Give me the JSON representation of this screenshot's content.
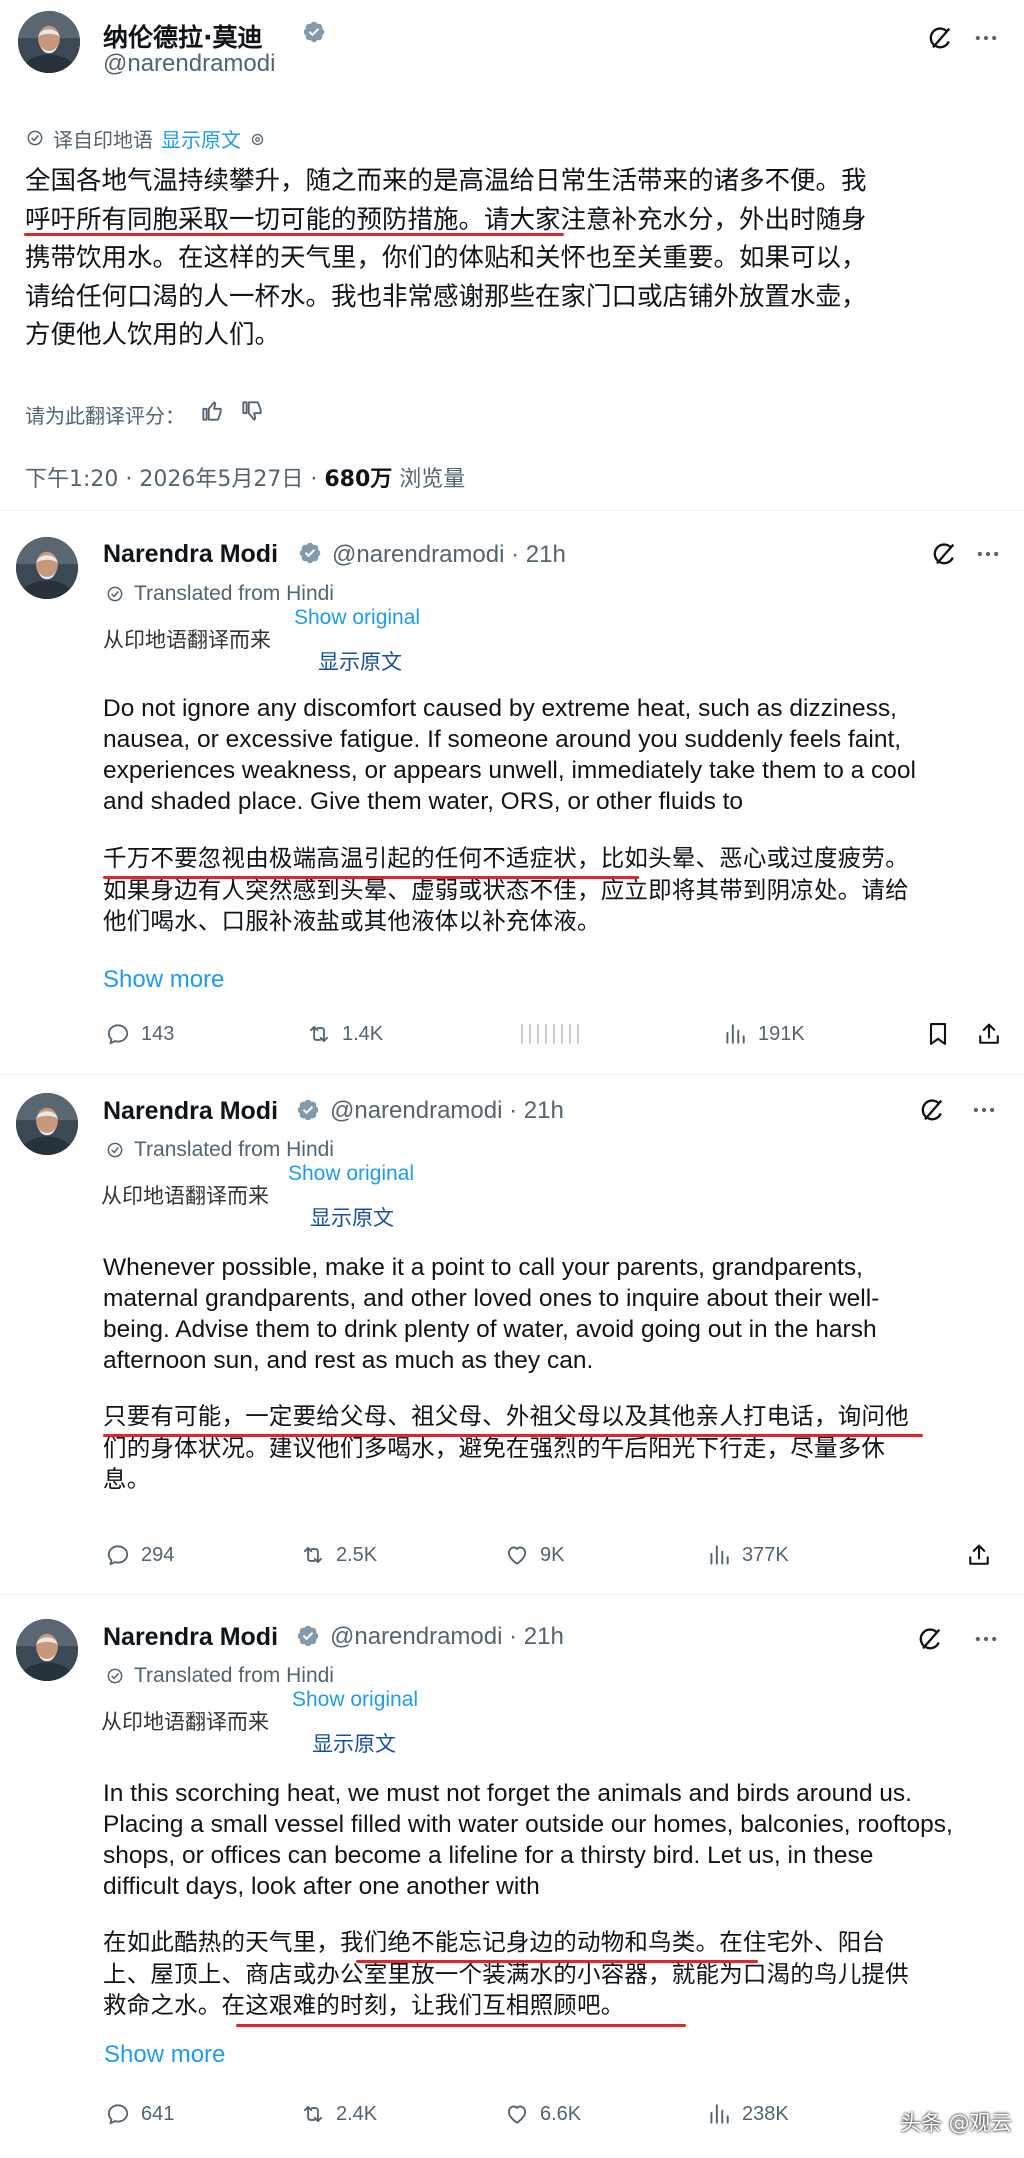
{
  "main_post": {
    "display_name": "纳伦德拉·莫迪",
    "handle": "@narendramodi",
    "translated_label": "译自印地语",
    "show_original": "显示原文",
    "body_lines": [
      "全国各地气温持续攀升，随之而来的是高温给日常生活带来的诸多不便。我",
      "呼吁所有同胞采取一切可能的预防措施。请大家注意补充水分，外出时随身",
      "携带饮用水。在这样的天气里，你们的体贴和关怀也至关重要。如果可以，",
      "请给任何口渴的人一杯水。我也非常感谢那些在家门口或店铺外放置水壶，",
      "方便他人饮用的人们。"
    ],
    "rate_label": "请为此翻译评分：",
    "timestamp": "下午1:20 · 2026年5月27日 ·",
    "views_count": "680万",
    "views_label": "浏览量"
  },
  "replies": [
    {
      "display_name": "Narendra Modi",
      "handle": "@narendramodi · 21h",
      "translated_from": "Translated from Hindi",
      "show_original": "Show original",
      "cn_translated_from": "从印地语翻译而来",
      "cn_show_original": "显示原文",
      "en_lines": [
        "Do not ignore any discomfort caused by extreme heat, such as dizziness,",
        "nausea, or excessive fatigue. If someone around you suddenly feels faint,",
        "experiences weakness, or appears unwell, immediately take them to a cool",
        "and shaded place. Give them water, ORS, or other fluids to"
      ],
      "cn_lines": [
        "千万不要忽视由极端高温引起的任何不适症状，比如头晕、恶心或过度疲劳。",
        "如果身边有人突然感到头晕、虚弱或状态不佳，应立即将其带到阴凉处。请给",
        "他们喝水、口服补液盐或其他液体以补充体液。"
      ],
      "show_more": "Show more",
      "replies": "143",
      "reposts": "1.4K",
      "likes": "",
      "views": "191K"
    },
    {
      "display_name": "Narendra Modi",
      "handle": "@narendramodi · 21h",
      "translated_from": "Translated from Hindi",
      "show_original": "Show original",
      "cn_translated_from": "从印地语翻译而来",
      "cn_show_original": "显示原文",
      "en_lines": [
        "Whenever possible, make it a point to call your parents, grandparents,",
        "maternal grandparents, and other loved ones to inquire about their well-",
        "being. Advise them to drink plenty of water, avoid going out in the harsh",
        "afternoon sun, and rest as much as they can."
      ],
      "cn_lines": [
        "只要有可能，一定要给父母、祖父母、外祖父母以及其他亲人打电话，询问他",
        "们的身体状况。建议他们多喝水，避免在强烈的午后阳光下行走，尽量多休",
        "息。"
      ],
      "show_more": "",
      "replies": "294",
      "reposts": "2.5K",
      "likes": "9K",
      "views": "377K"
    },
    {
      "display_name": "Narendra Modi",
      "handle": "@narendramodi · 21h",
      "translated_from": "Translated from Hindi",
      "show_original": "Show original",
      "cn_translated_from": "从印地语翻译而来",
      "cn_show_original": "显示原文",
      "en_lines": [
        "In this scorching heat, we must not forget the animals and birds around us.",
        "Placing a small vessel filled with water outside our homes, balconies, rooftops,",
        "shops, or offices can become a lifeline for a thirsty bird. Let us, in these",
        "difficult days, look after one another with"
      ],
      "cn_lines": [
        "在如此酷热的天气里，我们绝不能忘记身边的动物和鸟类。在住宅外、阳台",
        "上、屋顶上、商店或办公室里放一个装满水的小容器，就能为口渴的鸟儿提供",
        "救命之水。在这艰难的时刻，让我们互相照顾吧。"
      ],
      "show_more": "Show more",
      "replies": "641",
      "reposts": "2.4K",
      "likes": "6.6K",
      "views": "238K"
    }
  ],
  "watermark": "头条 @观云",
  "colors": {
    "text": "#0f1419",
    "gray": "#536471",
    "link": "#1d9bf0",
    "verified": "#829aab",
    "underline": "#e0262a"
  }
}
